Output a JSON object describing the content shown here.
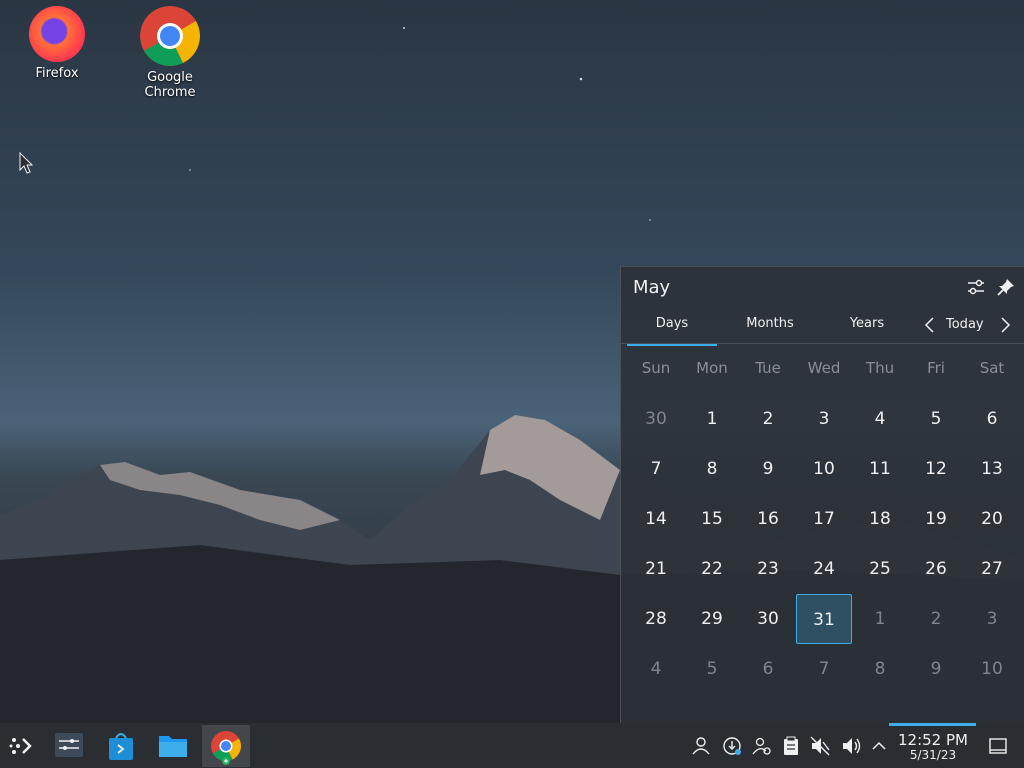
{
  "desktop": {
    "icons": [
      {
        "label": "Firefox",
        "icon": "firefox-icon"
      },
      {
        "label": "Google Chrome",
        "icon": "chrome-icon"
      }
    ]
  },
  "calendar": {
    "month": "May",
    "tabs": [
      {
        "label": "Days",
        "active": true
      },
      {
        "label": "Months",
        "active": false
      },
      {
        "label": "Years",
        "active": false
      }
    ],
    "today_label": "Today",
    "weekdays": [
      "Sun",
      "Mon",
      "Tue",
      "Wed",
      "Thu",
      "Fri",
      "Sat"
    ],
    "weeks": [
      [
        "30",
        "1",
        "2",
        "3",
        "4",
        "5",
        "6"
      ],
      [
        "7",
        "8",
        "9",
        "10",
        "11",
        "12",
        "13"
      ],
      [
        "14",
        "15",
        "16",
        "17",
        "18",
        "19",
        "20"
      ],
      [
        "21",
        "22",
        "23",
        "24",
        "25",
        "26",
        "27"
      ],
      [
        "28",
        "29",
        "30",
        "31",
        "1",
        "2",
        "3"
      ],
      [
        "4",
        "5",
        "6",
        "7",
        "8",
        "9",
        "10"
      ]
    ],
    "selected_day": "31",
    "accent": "#3daee9"
  },
  "taskbar": {
    "launchers": [
      "application-launcher-icon",
      "pager-icon",
      "discover-store-icon",
      "file-manager-icon",
      "chrome-icon"
    ],
    "tray": [
      "user-icon",
      "update-icon",
      "user-switch-icon",
      "clipboard-icon",
      "muted-speaker-icon",
      "volume-icon",
      "expand-arrow-icon"
    ],
    "clock": {
      "time": "12:52 PM",
      "date": "5/31/23"
    }
  }
}
